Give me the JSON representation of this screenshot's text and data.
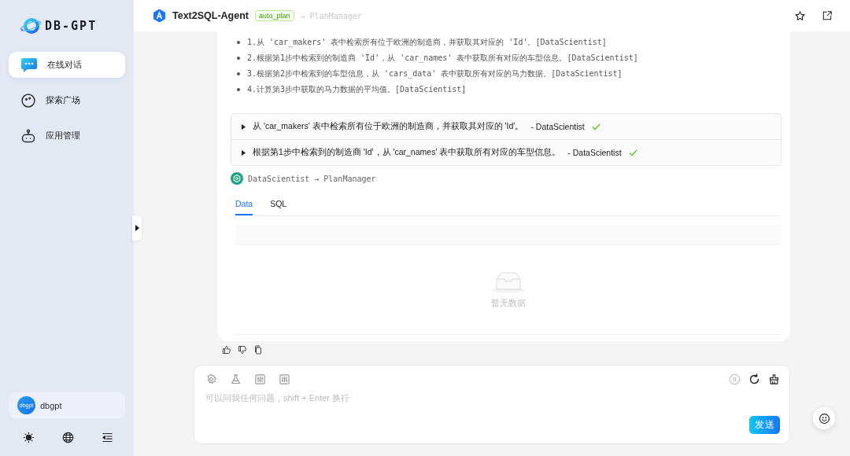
{
  "sidebar": {
    "logo": "DB-GPT",
    "nav": [
      {
        "label": "在线对话",
        "selected": true
      },
      {
        "label": "探索广场",
        "selected": false
      },
      {
        "label": "应用管理",
        "selected": false
      }
    ],
    "user": {
      "avatar": "dbgpt",
      "name": "dbgpt"
    }
  },
  "header": {
    "title": "Text2SQL-Agent",
    "tag": "auto_plan",
    "underlay": "→ PlanManager"
  },
  "plan_steps": [
    "1.从 'car_makers' 表中检索所有位于欧洲的制造商，并获取其对应的 'Id'。[DataScientist]",
    "2.根据第1步中检索到的制造商 'Id'，从 'car_names' 表中获取所有对应的车型信息。[DataScientist]",
    "3.根据第2步中检索到的车型信息，从 'cars_data' 表中获取所有对应的马力数据。[DataScientist]",
    "4.计算第3步中获取的马力数据的平均值。[DataScientist]"
  ],
  "tasks": [
    {
      "text": "从 'car_makers' 表中检索所有位于欧洲的制造商，并获取其对应的 'Id'。",
      "agent": "- DataScientist",
      "done": true,
      "expanded": false
    },
    {
      "text": "根据第1步中检索到的制造商 'Id'，从 'car_names' 表中获取所有对应的车型信息。",
      "agent": "- DataScientist",
      "done": true,
      "expanded": false
    }
  ],
  "message": {
    "from": "DataScientist",
    "arrow": "→",
    "to": "PlanManager"
  },
  "tabs": [
    {
      "label": "Data",
      "selected": true
    },
    {
      "label": "SQL",
      "selected": false
    }
  ],
  "empty_text": "暂无数据",
  "input": {
    "placeholder": "可以问我任何问题，shift + Enter 换行"
  },
  "send_button": "发送"
}
